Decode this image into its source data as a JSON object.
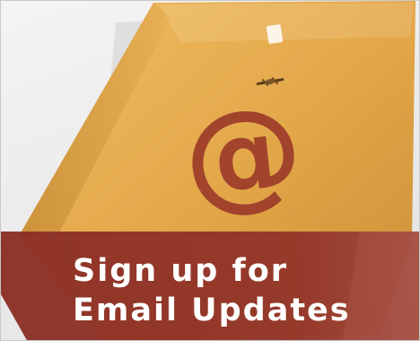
{
  "banner": {
    "headline_line1": "Sign up for",
    "headline_line2": "Email Updates",
    "at_symbol": "@",
    "icon": "envelope-icon"
  },
  "colors": {
    "envelope": "#e2a648",
    "envelope_shadow": "#c4882e",
    "at_symbol": "#a2442c",
    "band": "#8f3328",
    "band_light": "#b25a4d",
    "text": "#ffffff",
    "background": "#eeeeee"
  }
}
